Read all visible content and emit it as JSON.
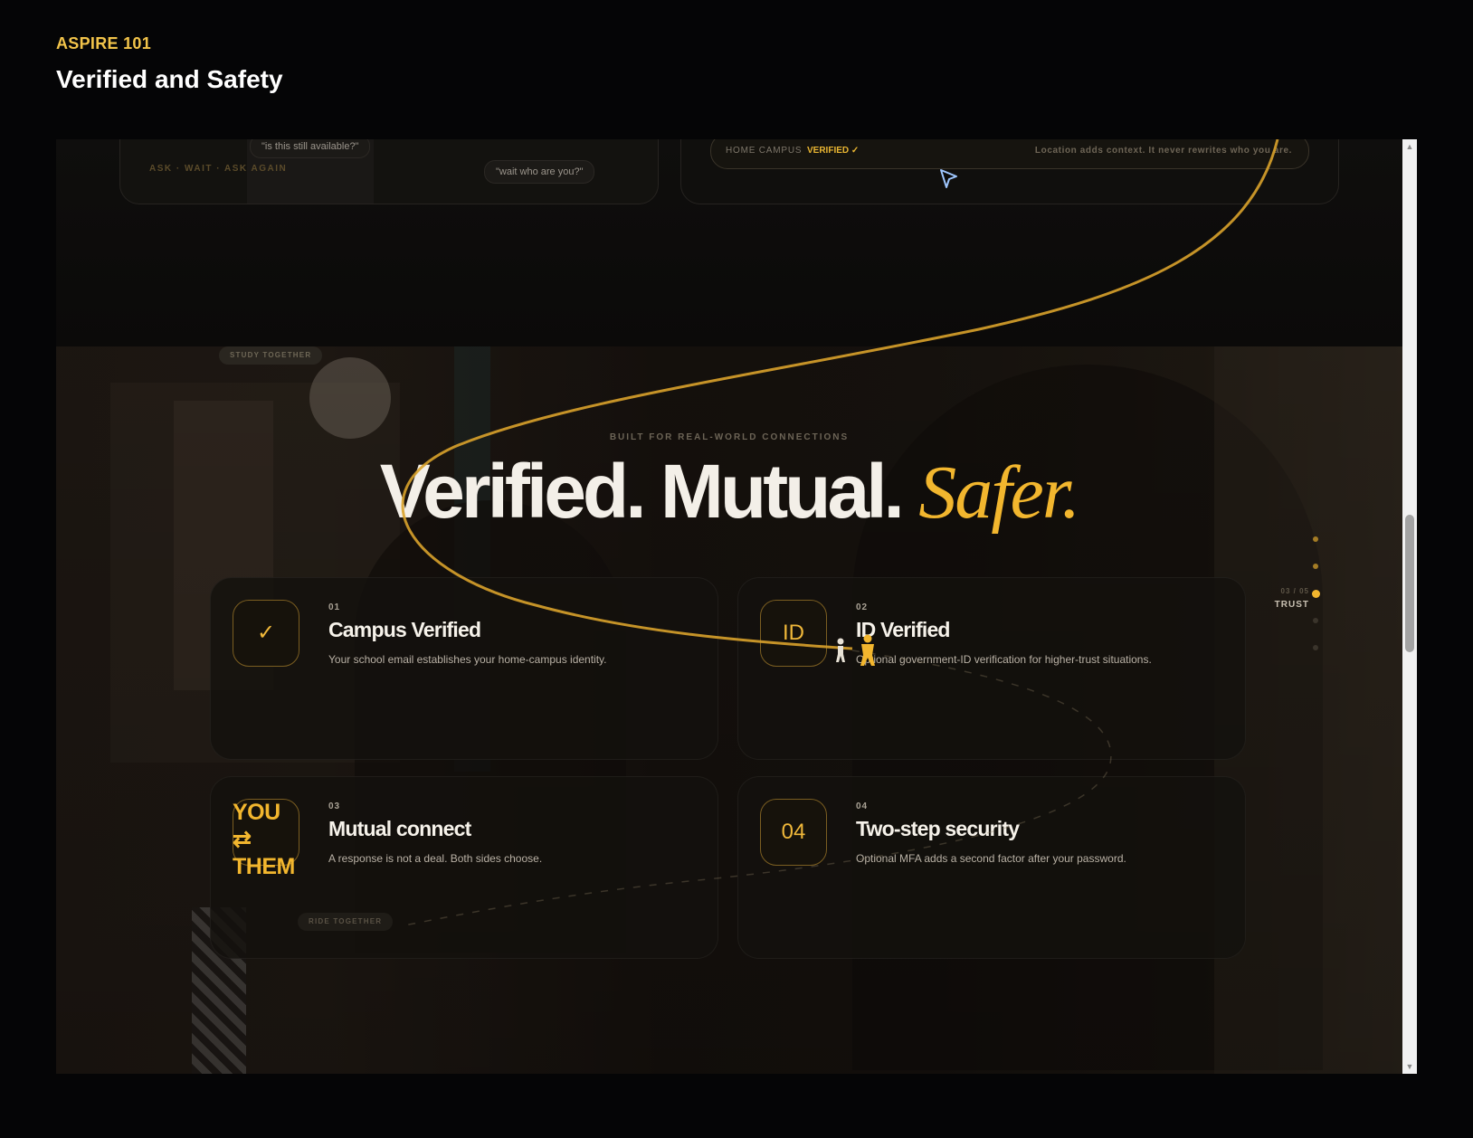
{
  "app": {
    "brand": "ASPIRE 101",
    "page_title": "Verified and Safety"
  },
  "top_section": {
    "chat_bubble_1": "\"is this still available?\"",
    "chat_bubble_2": "\"wait who are you?\"",
    "chat_caption": "ASK · WAIT · ASK AGAIN",
    "campus_label": "HOME CAMPUS",
    "campus_verified": "VERIFIED ✓",
    "campus_note": "Location adds context. It never rewrites who you are."
  },
  "hero": {
    "study_tag": "STUDY TOGETHER",
    "eyebrow": "BUILT FOR REAL-WORLD CONNECTIONS",
    "headline_part1": "Verified. Mutual.",
    "headline_accent": "Safer."
  },
  "features": [
    {
      "number": "01",
      "title": "Campus Verified",
      "description": "Your school email establishes your home-campus identity.",
      "badge": "✓"
    },
    {
      "number": "02",
      "title": "ID Verified",
      "description": "Optional government-ID verification for higher-trust situations.",
      "badge": "ID"
    },
    {
      "number": "03",
      "title": "Mutual connect",
      "description": "A response is not a deal. Both sides choose.",
      "badge_line1": "YOU",
      "badge_line2": "⇄",
      "badge_line3": "THEM"
    },
    {
      "number": "04",
      "title": "Two-step security",
      "description": "Optional MFA adds a second factor after your password.",
      "badge": "04"
    }
  ],
  "ride_tag": "RIDE TOGETHER",
  "section_nav": {
    "counter": "03 / 05",
    "label": "TRUST",
    "active_index": 2,
    "total": 5
  },
  "colors": {
    "accent": "#f2b62e",
    "background": "#050506",
    "card": "#14110d"
  },
  "icons": {
    "cursor": "cursor-arrow-icon",
    "scroll_up": "triangle-up-icon",
    "scroll_down": "triangle-down-icon"
  }
}
